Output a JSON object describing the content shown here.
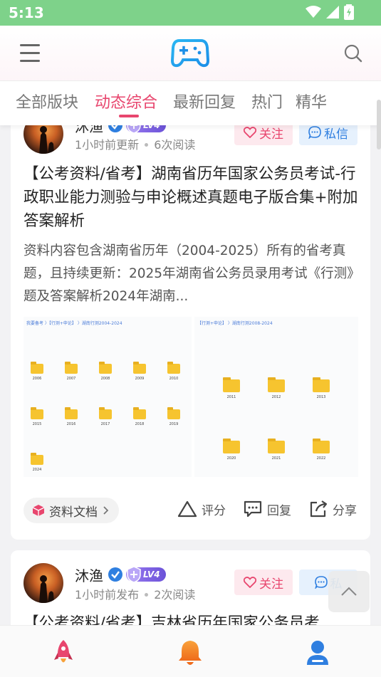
{
  "status_bar": {
    "time": "5:13"
  },
  "header": {
    "menu_icon": "menu-icon",
    "logo_icon": "gamepad-icon",
    "search_icon": "search-icon"
  },
  "tabs": [
    {
      "label": "全部版块",
      "active": false
    },
    {
      "label": "动态综合",
      "active": true
    },
    {
      "label": "最新回复",
      "active": false
    },
    {
      "label": "热门",
      "active": false
    },
    {
      "label": "精华",
      "active": false
    }
  ],
  "colors": {
    "accent": "#e8466e",
    "blue": "#2f7fe0",
    "status_bar": "#7ed28a"
  },
  "posts": [
    {
      "author": "沐渔",
      "level": "LV4",
      "time": "1小时前更新",
      "reads": "6次阅读",
      "follow_label": "关注",
      "dm_label": "私信",
      "title": "【公考资料/省考】湖南省历年国家公务员考试-行政职业能力测验与申论概述真题电子版合集+附加答案解析",
      "excerpt": "资料内容包含湖南省历年（2004-2025）所有的省考真题，且持续更新：2025年湖南省公务员录用考试《行测》题及答案解析2024年湖南...",
      "thumb_a": {
        "path": "我要备考 〉【行测+申论】 〉湖南行测2004-2024",
        "folders": [
          "2006",
          "2007",
          "2008",
          "2009",
          "2010",
          "2015",
          "2016",
          "2017",
          "2018",
          "2019",
          "2024"
        ]
      },
      "thumb_b": {
        "path": "【行测+申论】 〉湖南行测2008-2024",
        "folders": [
          "2011",
          "2012",
          "2013",
          "2020",
          "2021",
          "2022"
        ]
      },
      "tag": "资料文档",
      "actions": {
        "rate": "评分",
        "reply": "回复",
        "share": "分享"
      }
    },
    {
      "author": "沐渔",
      "level": "LV4",
      "time": "1小时前发布",
      "reads": "2次阅读",
      "follow_label": "关注",
      "dm_label": "私",
      "title": "【公考资料/省考】吉林省历年国家公务员考"
    }
  ],
  "bottom_nav": [
    {
      "icon": "rocket-icon",
      "color": "#e8466e"
    },
    {
      "icon": "bell-icon",
      "color": "#f08a1c"
    },
    {
      "icon": "user-icon",
      "color": "#2f7fe0"
    }
  ]
}
